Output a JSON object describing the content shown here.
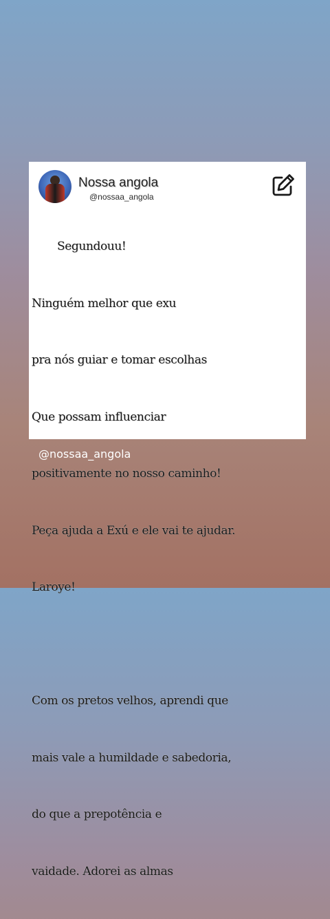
{
  "post": {
    "display_name": "Nossa angola",
    "handle": "@nossaa_angola",
    "edit_icon": "edit-icon",
    "lines": [
      "Segundouu!",
      "Ninguém melhor que exu",
      "pra nós guiar e tomar escolhas",
      "Que possam influenciar",
      "positivamente no nosso caminho!",
      "Peça ajuda a Exú e ele vai te ajudar.",
      "Laroye!",
      "",
      "Com os pretos velhos, aprendi que",
      "mais vale a humildade e sabedoria,",
      "do que a prepotência e",
      "vaidade. Adorei as almas"
    ]
  },
  "story": {
    "handle_watermark": "@nossaa_angola"
  },
  "colors": {
    "background_top": "#7fa5c8",
    "background_bottom": "#a37163",
    "card": "#ffffff",
    "text": "#161616"
  }
}
